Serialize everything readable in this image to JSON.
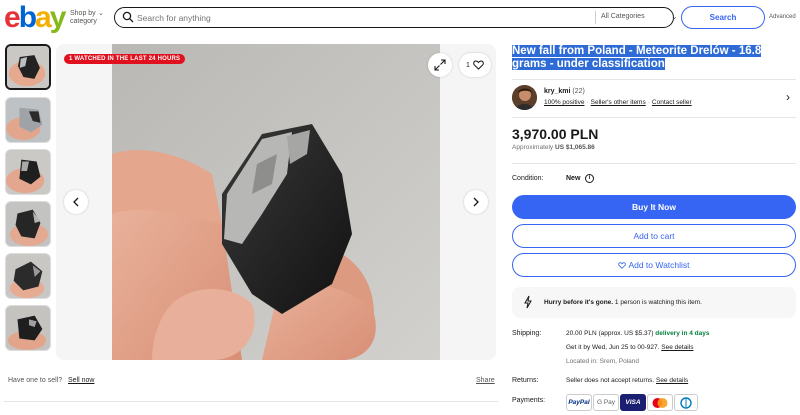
{
  "header": {
    "logo_letters": [
      "e",
      "b",
      "a",
      "y"
    ],
    "shop_by": "Shop by category",
    "search_placeholder": "Search for anything",
    "category": "All Categories",
    "search_button": "Search",
    "advanced": "Advanced"
  },
  "gallery": {
    "badge": "1 WATCHED IN THE LAST 24 HOURS",
    "watch_count": "1",
    "have_one": "Have one to sell?",
    "sell_now": "Sell now",
    "share": "Share"
  },
  "listing": {
    "title": "New fall from Poland - Meteorite Drelów - 16.8 grams - under classification",
    "seller": {
      "name": "kry_kmi",
      "count": "(22)",
      "positive": "100% positive",
      "other_items": "Seller's other items",
      "contact": "Contact seller"
    },
    "price": "3,970.00 PLN",
    "approx_label": "Approximately",
    "approx_value": "US $1,065.86",
    "condition_label": "Condition:",
    "condition_value": "New",
    "buy_now": "Buy It Now",
    "add_to_cart": "Add to cart",
    "add_to_watchlist": "Add to Watchlist",
    "hurry_bold": "Hurry before it's gone.",
    "hurry_rest": " 1 person is watching this item.",
    "shipping": {
      "label": "Shipping:",
      "cost": "20.00 PLN (approx. US $5.37)",
      "delivery": " delivery in 4 days",
      "get_it": "Get it by Wed, Jun 25 to 00-927.",
      "see_details": "See details",
      "located": "Located in: Srem, Poland"
    },
    "returns": {
      "label": "Returns:",
      "text": "Seller does not accept returns.",
      "see_details": "See details"
    },
    "payments": {
      "label": "Payments:",
      "methods": [
        "PayPal",
        "G Pay",
        "VISA",
        "Mastercard",
        "Diners"
      ]
    }
  },
  "colors": {
    "accent": "#3665f3",
    "badge": "#e0101e",
    "green": "#05823f",
    "title_highlight": "#2e6bd6"
  }
}
